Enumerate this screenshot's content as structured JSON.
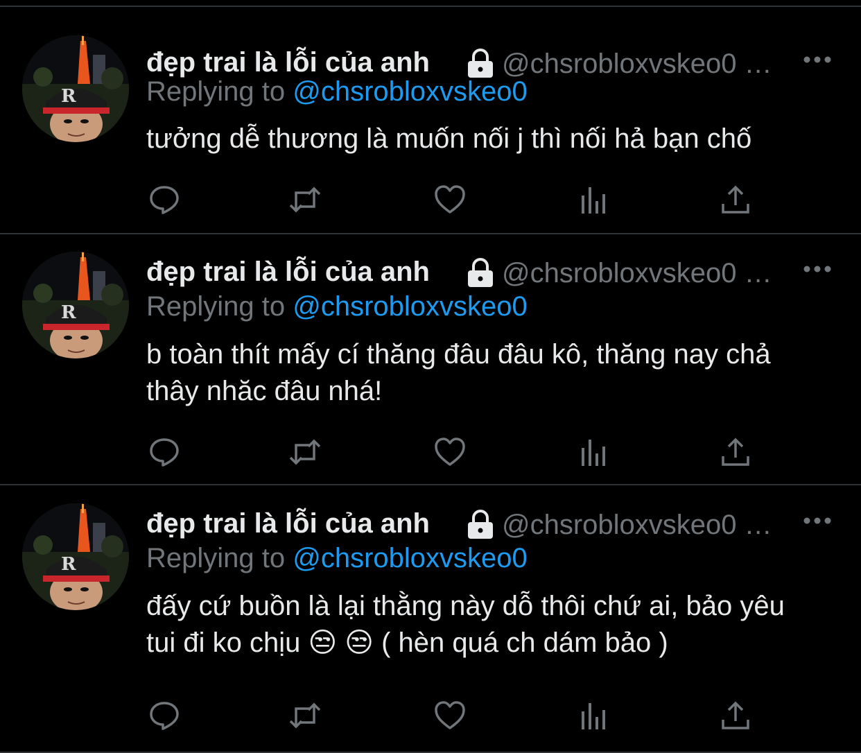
{
  "tweets": [
    {
      "display_name": "đẹp trai là lỗi của anh",
      "handle": "@chsrobloxvskeo0 …",
      "replying_prefix": "Replying to ",
      "replying_to": "@chsrobloxvskeo0",
      "text": "tưởng dễ thương là muốn nối j thì nối hả bạn chố"
    },
    {
      "display_name": "đẹp trai là lỗi của anh",
      "handle": "@chsrobloxvskeo0 …",
      "replying_prefix": "Replying to ",
      "replying_to": "@chsrobloxvskeo0",
      "text": "b toàn thít mấy cí thăng đâu đâu kô, thăng nay chả thây nhăc đâu nhá!"
    },
    {
      "display_name": "đẹp trai là lỗi của anh",
      "handle": "@chsrobloxvskeo0 …",
      "replying_prefix": "Replying to ",
      "replying_to": "@chsrobloxvskeo0",
      "text": "đấy cứ buồn là lại thằng này dỗ thôi chứ ai, bảo yêu tui đi ko chịu 😒 😒  ( hèn quá ch dám bảo )"
    }
  ],
  "icons": {
    "lock": "lock-icon",
    "more": "more-icon",
    "reply": "reply-icon",
    "retweet": "retweet-icon",
    "like": "heart-icon",
    "views": "analytics-icon",
    "share": "share-icon"
  },
  "colors": {
    "background": "#000000",
    "text": "#e7e9ea",
    "secondary": "#71767b",
    "accent": "#1d9bf0",
    "divider": "#2f3336"
  }
}
